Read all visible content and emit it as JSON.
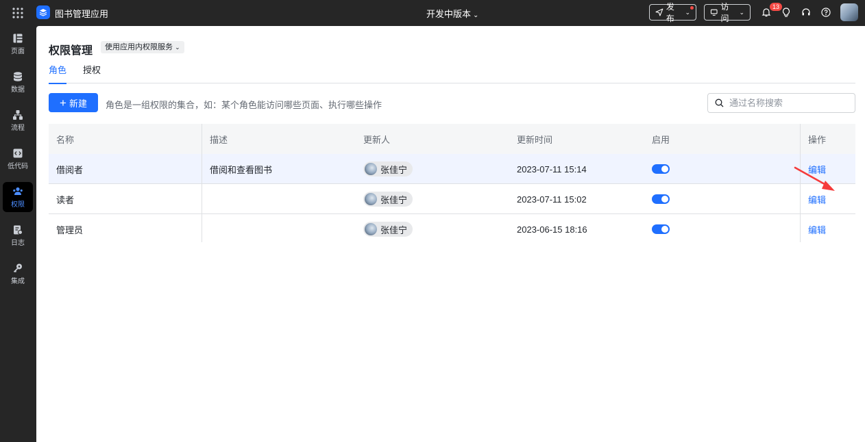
{
  "topbar": {
    "app_name": "图书管理应用",
    "version": "开发中版本",
    "publish_label": "发布",
    "visit_label": "访问",
    "notification_count": "13"
  },
  "sidebar": {
    "items": [
      {
        "label": "页面",
        "icon": "pages-icon"
      },
      {
        "label": "数据",
        "icon": "database-icon"
      },
      {
        "label": "流程",
        "icon": "flow-icon"
      },
      {
        "label": "低代码",
        "icon": "code-icon"
      },
      {
        "label": "权限",
        "icon": "users-icon",
        "active": true
      },
      {
        "label": "日志",
        "icon": "log-icon"
      },
      {
        "label": "集成",
        "icon": "key-icon"
      }
    ]
  },
  "main": {
    "title": "权限管理",
    "service_select": "使用应用内权限服务",
    "tabs": [
      "角色",
      "授权"
    ],
    "new_button": "新建",
    "hint": "角色是一组权限的集合，如：某个角色能访问哪些页面、执行哪些操作",
    "search_placeholder": "通过名称搜索"
  },
  "table": {
    "headers": [
      "名称",
      "描述",
      "更新人",
      "更新时间",
      "启用",
      "操作"
    ],
    "rows": [
      {
        "name": "借阅者",
        "desc": "借阅和查看图书",
        "user": "张佳宁",
        "time": "2023-07-11 15:14",
        "enabled": true,
        "op": "编辑"
      },
      {
        "name": "读者",
        "desc": "",
        "user": "张佳宁",
        "time": "2023-07-11 15:02",
        "enabled": true,
        "op": "编辑"
      },
      {
        "name": "管理员",
        "desc": "",
        "user": "张佳宁",
        "time": "2023-06-15 18:16",
        "enabled": true,
        "op": "编辑"
      }
    ]
  },
  "colors": {
    "accent": "#1f6fff",
    "annotation_arrow": "#f53b3b"
  }
}
